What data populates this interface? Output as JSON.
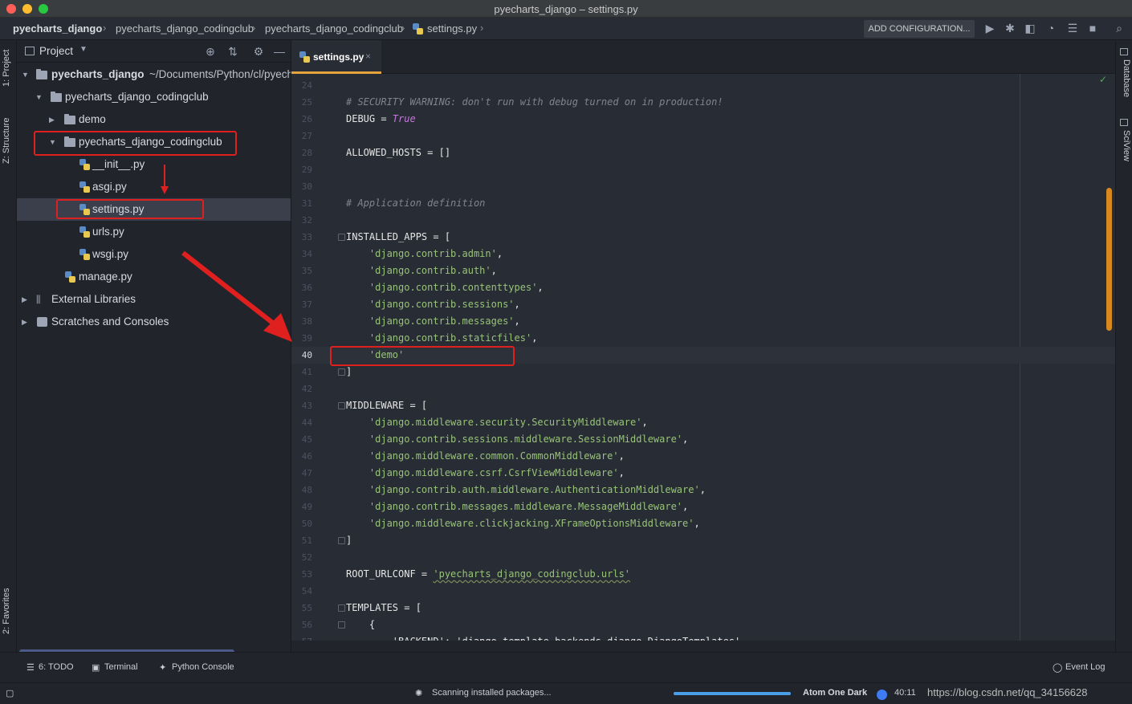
{
  "window": {
    "title": "pyecharts_django – settings.py"
  },
  "breadcrumbs": [
    "pyecharts_django",
    "pyecharts_django_codingclub",
    "pyecharts_django_codingclub",
    "settings.py"
  ],
  "toolbar": {
    "add_config_label": "ADD CONFIGURATION..."
  },
  "left_stripe": {
    "project_tab": "1: Project",
    "structure_tab": "Z: Structure",
    "favorites_tab": "2: Favorites"
  },
  "right_stripe": {
    "database_tab": "Database",
    "sciview_tab": "SciView"
  },
  "project_panel": {
    "header_label": "Project",
    "tree": [
      {
        "label": "pyecharts_django",
        "suffix": "~/Documents/Python/cl/pyecharts_django"
      },
      {
        "label": "pyecharts_django_codingclub"
      },
      {
        "label": "demo"
      },
      {
        "label": "pyecharts_django_codingclub"
      },
      {
        "label": "__init__.py"
      },
      {
        "label": "asgi.py"
      },
      {
        "label": "settings.py"
      },
      {
        "label": "urls.py"
      },
      {
        "label": "wsgi.py"
      },
      {
        "label": "manage.py"
      },
      {
        "label": "External Libraries"
      },
      {
        "label": "Scratches and Consoles"
      }
    ]
  },
  "editor": {
    "tab_label": "settings.py",
    "lines": [
      {
        "n": "24",
        "t": ""
      },
      {
        "n": "25",
        "t": "# SECURITY WARNING: don't run with debug turned on in production!"
      },
      {
        "n": "26",
        "t": "DEBUG = ",
        "kw": "True"
      },
      {
        "n": "27",
        "t": ""
      },
      {
        "n": "28",
        "t": "ALLOWED_HOSTS = []"
      },
      {
        "n": "29",
        "t": ""
      },
      {
        "n": "30",
        "t": ""
      },
      {
        "n": "31",
        "t": "# Application definition"
      },
      {
        "n": "32",
        "t": ""
      },
      {
        "n": "33",
        "t": "INSTALLED_APPS = ["
      },
      {
        "n": "34",
        "s": "'django.contrib.admin'",
        "e": ","
      },
      {
        "n": "35",
        "s": "'django.contrib.auth'",
        "e": ","
      },
      {
        "n": "36",
        "s": "'django.contrib.contenttypes'",
        "e": ","
      },
      {
        "n": "37",
        "s": "'django.contrib.sessions'",
        "e": ","
      },
      {
        "n": "38",
        "s": "'django.contrib.messages'",
        "e": ","
      },
      {
        "n": "39",
        "s": "'django.contrib.staticfiles'",
        "e": ","
      },
      {
        "n": "40",
        "s": "'demo'",
        "e": ""
      },
      {
        "n": "41",
        "t": "]"
      },
      {
        "n": "42",
        "t": ""
      },
      {
        "n": "43",
        "t": "MIDDLEWARE = ["
      },
      {
        "n": "44",
        "s": "'django.middleware.security.SecurityMiddleware'",
        "e": ","
      },
      {
        "n": "45",
        "s": "'django.contrib.sessions.middleware.SessionMiddleware'",
        "e": ","
      },
      {
        "n": "46",
        "s": "'django.middleware.common.CommonMiddleware'",
        "e": ","
      },
      {
        "n": "47",
        "s": "'django.middleware.csrf.CsrfViewMiddleware'",
        "e": ","
      },
      {
        "n": "48",
        "s": "'django.contrib.auth.middleware.AuthenticationMiddleware'",
        "e": ","
      },
      {
        "n": "49",
        "s": "'django.contrib.messages.middleware.MessageMiddleware'",
        "e": ","
      },
      {
        "n": "50",
        "s": "'django.middleware.clickjacking.XFrameOptionsMiddleware'",
        "e": ","
      },
      {
        "n": "51",
        "t": "]"
      },
      {
        "n": "52",
        "t": ""
      },
      {
        "n": "53",
        "t": "ROOT_URLCONF = ",
        "s": "'pyecharts_django_codingclub.urls'"
      },
      {
        "n": "54",
        "t": ""
      },
      {
        "n": "55",
        "t": "TEMPLATES = ["
      },
      {
        "n": "56",
        "t": "    {"
      },
      {
        "n": "57",
        "t": "        'BACKEND': 'django.template.backends.django.DjangoTemplates',"
      }
    ]
  },
  "bottom_tools": {
    "todo": "6: TODO",
    "terminal": "Terminal",
    "python_console": "Python Console",
    "event_log": "Event Log"
  },
  "status": {
    "task": "Scanning installed packages...",
    "progress": 1.0,
    "theme": "Atom One Dark",
    "position": "40:11",
    "watermark": "https://blog.csdn.net/qq_34156628"
  },
  "colors": {
    "accent_tab": "#e5a33d",
    "highlight_red": "#e0201e",
    "scroll_thumb": "#d7891e"
  }
}
